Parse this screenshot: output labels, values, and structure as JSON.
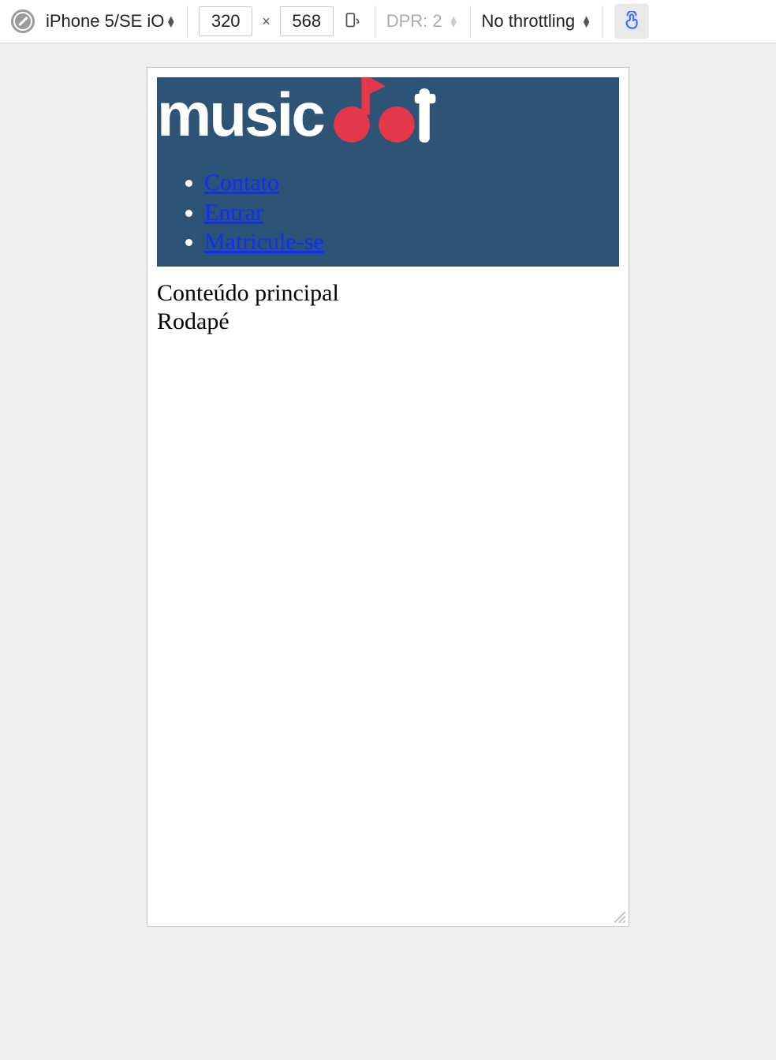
{
  "toolbar": {
    "device": "iPhone 5/SE",
    "os": "iO",
    "width": "320",
    "height": "568",
    "dpr_label": "DPR: 2",
    "throttling": "No throttling"
  },
  "page": {
    "logo_text_left": "music",
    "logo_text_right": "dot",
    "nav": [
      {
        "label": "Contato"
      },
      {
        "label": "Entrar"
      },
      {
        "label": "Matricule-se"
      }
    ],
    "main": "Conteúdo principal",
    "footer": "Rodapé"
  }
}
